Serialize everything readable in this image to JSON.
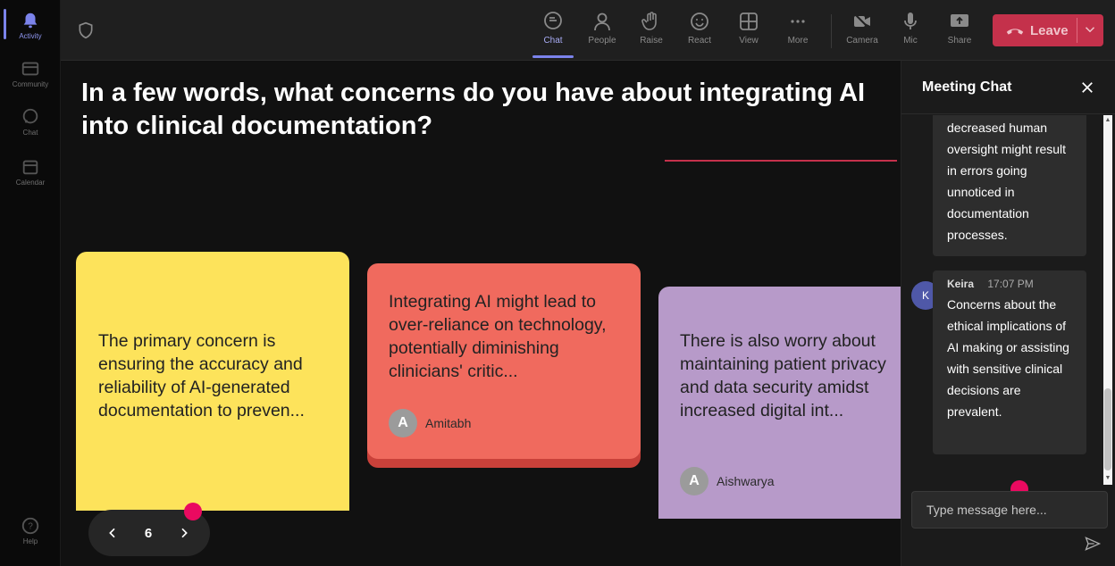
{
  "rail": {
    "items": [
      {
        "label": "Activity"
      },
      {
        "label": "Community"
      },
      {
        "label": "Chat"
      },
      {
        "label": "Calendar"
      }
    ],
    "help": "Help"
  },
  "toolbar": {
    "chat": "Chat",
    "people": "People",
    "raise": "Raise",
    "react": "React",
    "view": "View",
    "more": "More",
    "camera": "Camera",
    "mic": "Mic",
    "share": "Share",
    "leave": "Leave"
  },
  "stage": {
    "question": "In a few words, what concerns do you have about integrating AI into clinical documentation?",
    "cards": [
      {
        "text": "The primary concern is ensuring the accuracy and reliability of AI-generated documentation to preven...",
        "color": "#fde35b"
      },
      {
        "text": "Integrating AI might lead to over-reliance on technology, potentially diminishing clinicians' critic...",
        "author": "Amitabh",
        "initial": "A",
        "color": "#f06a5e"
      },
      {
        "text": "There is also worry about maintaining patient privacy and data security amidst increased digital int...",
        "author": "Aishwarya",
        "initial": "A",
        "color": "#b79ac9"
      }
    ],
    "page": "6"
  },
  "chat": {
    "title": "Meeting Chat",
    "messages": [
      {
        "text": "decreased human oversight might result in errors going unnoticed in documentation processes."
      },
      {
        "sender": "Keira",
        "initial": "K",
        "time": "17:07 PM",
        "text": "Concerns about the ethical implications of AI making or assisting with sensitive clinical decisions are prevalent."
      }
    ],
    "input_placeholder": "Type message here..."
  },
  "colors": {
    "accent": "#7b83eb",
    "leave": "#c4314b",
    "marker": "#ea0a60"
  }
}
